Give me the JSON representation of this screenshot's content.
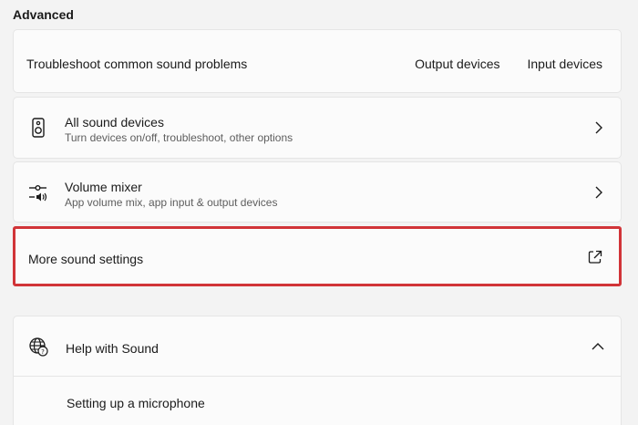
{
  "section": {
    "title": "Advanced"
  },
  "troubleshoot": {
    "label": "Troubleshoot common sound problems",
    "links": [
      "Output devices",
      "Input devices"
    ]
  },
  "rows": [
    {
      "title": "All sound devices",
      "subtitle": "Turn devices on/off, troubleshoot, other options",
      "icon": "speaker-icon"
    },
    {
      "title": "Volume mixer",
      "subtitle": "App volume mix, app input & output devices",
      "icon": "volume-mixer-icon"
    }
  ],
  "more": {
    "label": "More sound settings",
    "icon": "open-external-icon",
    "highlight_color": "#d13438"
  },
  "help": {
    "title": "Help with Sound",
    "icon": "globe-help-icon",
    "links": [
      "Setting up a microphone"
    ]
  }
}
